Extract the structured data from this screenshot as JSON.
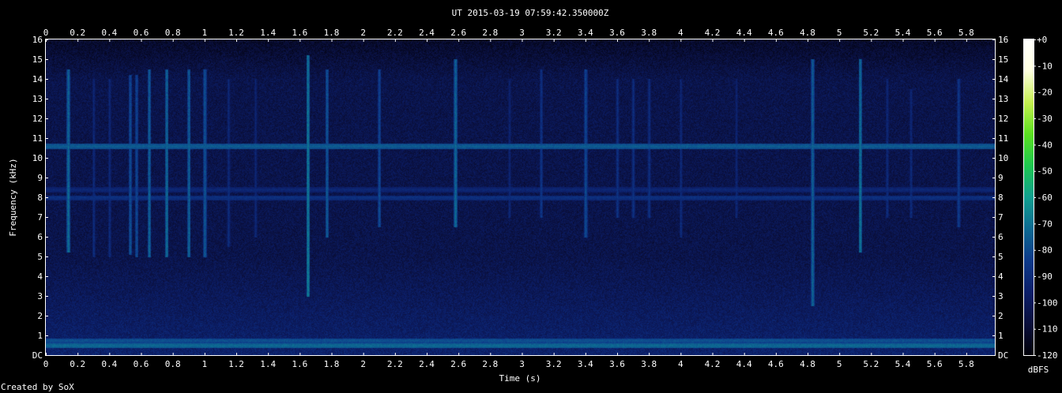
{
  "chart_data": {
    "type": "heatmap",
    "title": "UT 2015-03-19 07:59:42.350000Z",
    "xlabel": "Time (s)",
    "ylabel": "Frequency (kHz)",
    "xlim": [
      0,
      5.98
    ],
    "ylim": [
      0,
      16
    ],
    "x_tick_labels": [
      "0",
      "0.2",
      "0.4",
      "0.6",
      "0.8",
      "1",
      "1.2",
      "1.4",
      "1.6",
      "1.8",
      "2",
      "2.2",
      "2.4",
      "2.6",
      "2.8",
      "3",
      "3.2",
      "3.4",
      "3.6",
      "3.8",
      "4",
      "4.2",
      "4.4",
      "4.6",
      "4.8",
      "5",
      "5.2",
      "5.4",
      "5.6",
      "5.8"
    ],
    "x_tick_values": [
      0,
      0.2,
      0.4,
      0.6,
      0.8,
      1,
      1.2,
      1.4,
      1.6,
      1.8,
      2,
      2.2,
      2.4,
      2.6,
      2.8,
      3,
      3.2,
      3.4,
      3.6,
      3.8,
      4,
      4.2,
      4.4,
      4.6,
      4.8,
      5,
      5.2,
      5.4,
      5.6,
      5.8
    ],
    "y_tick_labels": [
      "DC",
      "1",
      "2",
      "3",
      "4",
      "5",
      "6",
      "7",
      "8",
      "9",
      "10",
      "11",
      "12",
      "13",
      "14",
      "15",
      "16"
    ],
    "y_tick_values": [
      0,
      1,
      2,
      3,
      4,
      5,
      6,
      7,
      8,
      9,
      10,
      11,
      12,
      13,
      14,
      15,
      16
    ],
    "colorbar": {
      "label": "dBFS",
      "range": [
        -120,
        0
      ],
      "tick_labels": [
        "+0",
        "-10",
        "-20",
        "-30",
        "-40",
        "-50",
        "-60",
        "-70",
        "-80",
        "-90",
        "-100",
        "-110",
        "-120"
      ],
      "tick_values": [
        0,
        -10,
        -20,
        -30,
        -40,
        -50,
        -60,
        -70,
        -80,
        -90,
        -100,
        -110,
        -120
      ],
      "colors": [
        "#000008",
        "#0a0f3c",
        "#0c1f6a",
        "#0d3a8a",
        "#0d6a92",
        "#11a090",
        "#1ec850",
        "#5be020",
        "#c6f050",
        "#ffffe0",
        "#ffffff"
      ]
    },
    "horizontal_lines_khz": [
      {
        "freq": 10.6,
        "level_dbfs": -75
      },
      {
        "freq": 8.4,
        "level_dbfs": -92
      },
      {
        "freq": 8.0,
        "level_dbfs": -88
      },
      {
        "freq": 0.5,
        "level_dbfs": -72
      },
      {
        "freq": 0.75,
        "level_dbfs": -78
      }
    ],
    "vertical_streaks": [
      {
        "t": 0.14,
        "f_low": 5.2,
        "f_high": 14.5,
        "level_dbfs": -70
      },
      {
        "t": 0.3,
        "f_low": 5.0,
        "f_high": 14.0,
        "level_dbfs": -88
      },
      {
        "t": 0.4,
        "f_low": 5.0,
        "f_high": 14.0,
        "level_dbfs": -88
      },
      {
        "t": 0.53,
        "f_low": 5.1,
        "f_high": 14.2,
        "level_dbfs": -76
      },
      {
        "t": 0.57,
        "f_low": 5.0,
        "f_high": 14.2,
        "level_dbfs": -78
      },
      {
        "t": 0.65,
        "f_low": 5.0,
        "f_high": 14.5,
        "level_dbfs": -72
      },
      {
        "t": 0.76,
        "f_low": 5.0,
        "f_high": 14.5,
        "level_dbfs": -70
      },
      {
        "t": 0.9,
        "f_low": 5.0,
        "f_high": 14.5,
        "level_dbfs": -72
      },
      {
        "t": 1.0,
        "f_low": 5.0,
        "f_high": 14.5,
        "level_dbfs": -75
      },
      {
        "t": 1.15,
        "f_low": 5.5,
        "f_high": 14.0,
        "level_dbfs": -88
      },
      {
        "t": 1.32,
        "f_low": 6.0,
        "f_high": 14.0,
        "level_dbfs": -90
      },
      {
        "t": 1.65,
        "f_low": 3.0,
        "f_high": 15.2,
        "level_dbfs": -66
      },
      {
        "t": 1.77,
        "f_low": 6.0,
        "f_high": 14.5,
        "level_dbfs": -74
      },
      {
        "t": 2.1,
        "f_low": 6.5,
        "f_high": 14.5,
        "level_dbfs": -78
      },
      {
        "t": 2.58,
        "f_low": 6.5,
        "f_high": 15.0,
        "level_dbfs": -70
      },
      {
        "t": 2.92,
        "f_low": 7.0,
        "f_high": 14.0,
        "level_dbfs": -90
      },
      {
        "t": 3.12,
        "f_low": 7.0,
        "f_high": 14.5,
        "level_dbfs": -84
      },
      {
        "t": 3.4,
        "f_low": 6.0,
        "f_high": 14.5,
        "level_dbfs": -78
      },
      {
        "t": 3.6,
        "f_low": 7.0,
        "f_high": 14.0,
        "level_dbfs": -86
      },
      {
        "t": 3.7,
        "f_low": 7.0,
        "f_high": 14.0,
        "level_dbfs": -86
      },
      {
        "t": 3.8,
        "f_low": 7.0,
        "f_high": 14.0,
        "level_dbfs": -86
      },
      {
        "t": 4.0,
        "f_low": 6.0,
        "f_high": 14.0,
        "level_dbfs": -88
      },
      {
        "t": 4.35,
        "f_low": 7.0,
        "f_high": 14.0,
        "level_dbfs": -90
      },
      {
        "t": 4.83,
        "f_low": 2.5,
        "f_high": 15.0,
        "level_dbfs": -72
      },
      {
        "t": 5.13,
        "f_low": 5.2,
        "f_high": 15.0,
        "level_dbfs": -68
      },
      {
        "t": 5.3,
        "f_low": 7.0,
        "f_high": 14.0,
        "level_dbfs": -88
      },
      {
        "t": 5.45,
        "f_low": 7.0,
        "f_high": 13.5,
        "level_dbfs": -88
      },
      {
        "t": 5.75,
        "f_low": 6.5,
        "f_high": 14.0,
        "level_dbfs": -82
      }
    ],
    "noise_floor_dbfs": -104,
    "grid": false
  },
  "footer": {
    "credit": "Created by SoX"
  }
}
